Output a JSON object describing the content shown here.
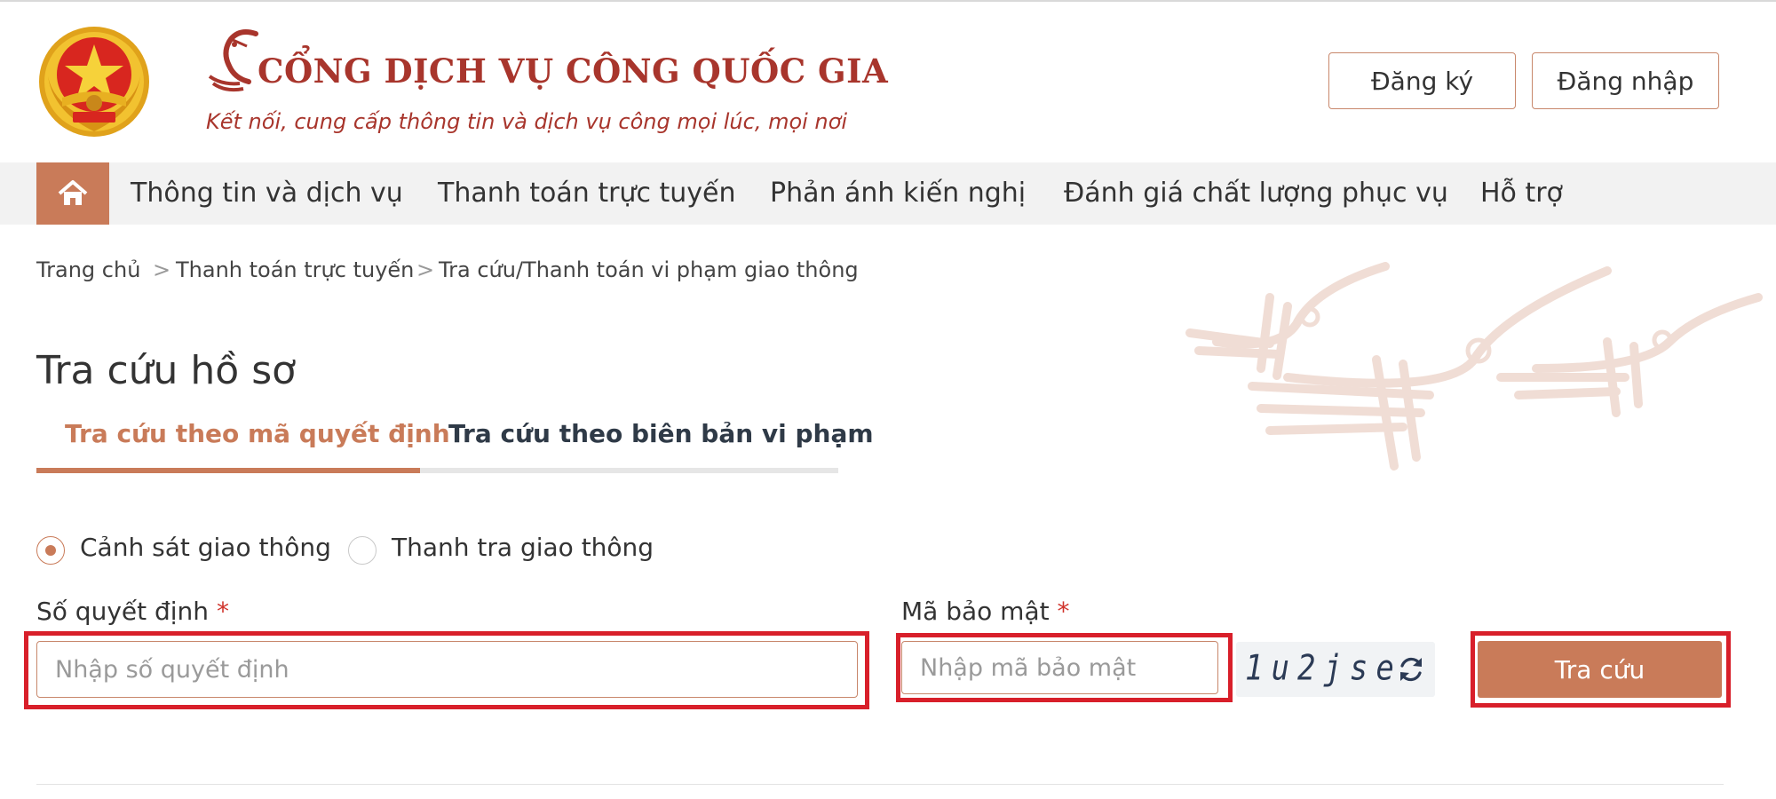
{
  "header": {
    "title": "CỔNG DỊCH VỤ CÔNG QUỐC GIA",
    "subtitle": "Kết nối, cung cấp thông tin và dịch vụ công mọi lúc, mọi nơi",
    "register_label": "Đăng ký",
    "login_label": "Đăng nhập"
  },
  "nav": {
    "home_icon": "home-icon",
    "items": [
      {
        "label": "Thông tin và dịch vụ"
      },
      {
        "label": "Thanh toán trực tuyến"
      },
      {
        "label": "Phản ánh kiến nghị"
      },
      {
        "label": "Đánh giá chất lượng phục vụ"
      },
      {
        "label": "Hỗ trợ"
      }
    ]
  },
  "breadcrumb": [
    {
      "label": "Trang chủ"
    },
    {
      "label": "Thanh toán trực tuyến"
    },
    {
      "label": "Tra cứu/Thanh toán vi phạm giao thông"
    }
  ],
  "breadcrumb_separator": ">",
  "page": {
    "title": "Tra cứu hồ sơ",
    "tabs": [
      {
        "label": "Tra cứu theo mã quyết định",
        "active": true
      },
      {
        "label": "Tra cứu theo biên bản vi phạm",
        "active": false
      }
    ]
  },
  "radios": [
    {
      "label": "Cảnh sát giao thông",
      "checked": true
    },
    {
      "label": "Thanh tra giao thông",
      "checked": false
    }
  ],
  "form": {
    "decision_label": "Số quyết định",
    "decision_placeholder": "Nhập số quyết định",
    "decision_value": "",
    "captcha_label": "Mã bảo mật",
    "captcha_placeholder": "Nhập mã bảo mật",
    "captcha_value": "",
    "captcha_code": "1u2jse",
    "required_mark": "*",
    "submit_label": "Tra cứu"
  },
  "colors": {
    "accent": "#c97b59",
    "brand": "#a8352c",
    "highlight": "#d81f2a"
  }
}
